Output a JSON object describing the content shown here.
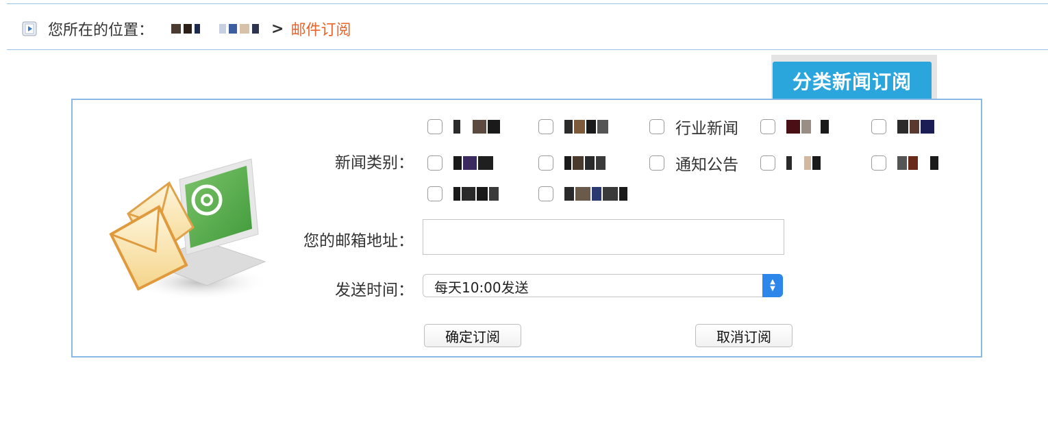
{
  "breadcrumb": {
    "label": "您所在的位置：",
    "separator": ">",
    "current": "邮件订阅"
  },
  "tab": {
    "label": "分类新闻订阅"
  },
  "form": {
    "category_label": "新闻类别：",
    "categories_row1": [
      "",
      "",
      "行业新闻",
      "",
      ""
    ],
    "categories_row2": [
      "",
      "",
      "通知公告",
      "",
      ""
    ],
    "categories_row3": [
      "",
      ""
    ],
    "email_label": "您的邮箱地址：",
    "email_value": "",
    "email_placeholder": "",
    "time_label": "发送时间：",
    "time_selected": "每天10:00发送",
    "confirm_button": "确定订阅",
    "cancel_button": "取消订阅"
  },
  "colors": {
    "accent_blue": "#2aa6dc",
    "current_orange": "#e8632a",
    "panel_border": "#8ab8e6"
  },
  "icons": {
    "breadcrumb_icon": "play-arrow-icon",
    "illustration": "mail-envelope-icon"
  }
}
